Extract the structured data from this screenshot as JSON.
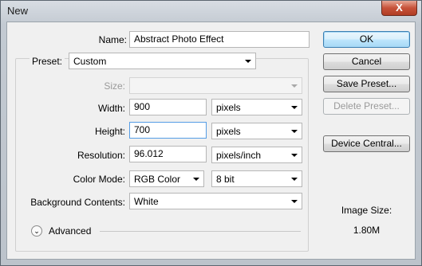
{
  "window": {
    "title": "New",
    "close_label": "X"
  },
  "form": {
    "name_label": "Name:",
    "name_value": "Abstract Photo Effect",
    "preset_label": "Preset:",
    "preset_value": "Custom",
    "size_label": "Size:",
    "size_value": "",
    "width_label": "Width:",
    "width_value": "900",
    "width_unit": "pixels",
    "height_label": "Height:",
    "height_value": "700",
    "height_unit": "pixels",
    "resolution_label": "Resolution:",
    "resolution_value": "96.012",
    "resolution_unit": "pixels/inch",
    "color_mode_label": "Color Mode:",
    "color_mode_value": "RGB Color",
    "bit_depth_value": "8 bit",
    "background_label": "Background Contents:",
    "background_value": "White",
    "advanced_label": "Advanced"
  },
  "buttons": {
    "ok": "OK",
    "cancel": "Cancel",
    "save_preset": "Save Preset...",
    "delete_preset": "Delete Preset...",
    "device_central": "Device Central..."
  },
  "image_size": {
    "label": "Image Size:",
    "value": "1.80M"
  }
}
